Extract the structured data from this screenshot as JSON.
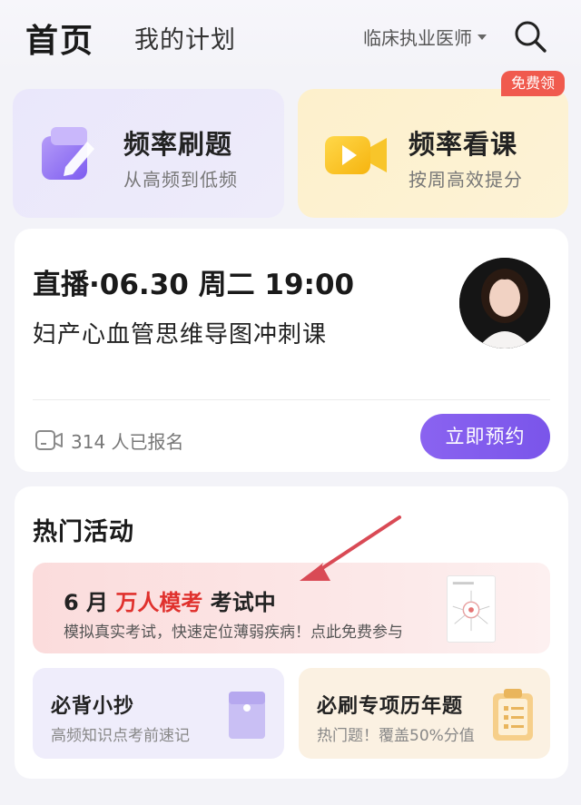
{
  "header": {
    "tab_home": "首页",
    "tab_plan": "我的计划",
    "exam_type": "临床执业医师",
    "search_icon": "search-icon"
  },
  "features": {
    "practice": {
      "title": "频率刷题",
      "subtitle": "从高频到低频",
      "icon": "book-pen-icon"
    },
    "course": {
      "title": "频率看课",
      "subtitle": "按周高效提分",
      "icon": "video-play-icon",
      "badge": "免费领"
    }
  },
  "live": {
    "title": "直播·06.30 周二 19:00",
    "course_name": "妇产心血管思维导图冲刺课",
    "signup_count": "314 人已报名",
    "book_button": "立即预约"
  },
  "activities": {
    "section_title": "热门活动",
    "banner": {
      "title_prefix": "6 月",
      "title_highlight": "万人模考",
      "title_suffix": "考试中",
      "subtitle": "模拟真实考试，快速定位薄弱疾病！点此免费参与"
    },
    "notes": {
      "title": "必背小抄",
      "subtitle": "高频知识点考前速记",
      "icon": "envelope-folder-icon"
    },
    "past_papers": {
      "title": "必刷专项历年题",
      "subtitle": "热门题！覆盖50%分值",
      "icon": "clipboard-icon"
    }
  },
  "colors": {
    "accent_purple": "#7a55ea",
    "badge_red": "#f05a4e",
    "highlight_red": "#e0312d",
    "annotation_arrow": "#d94a55"
  }
}
